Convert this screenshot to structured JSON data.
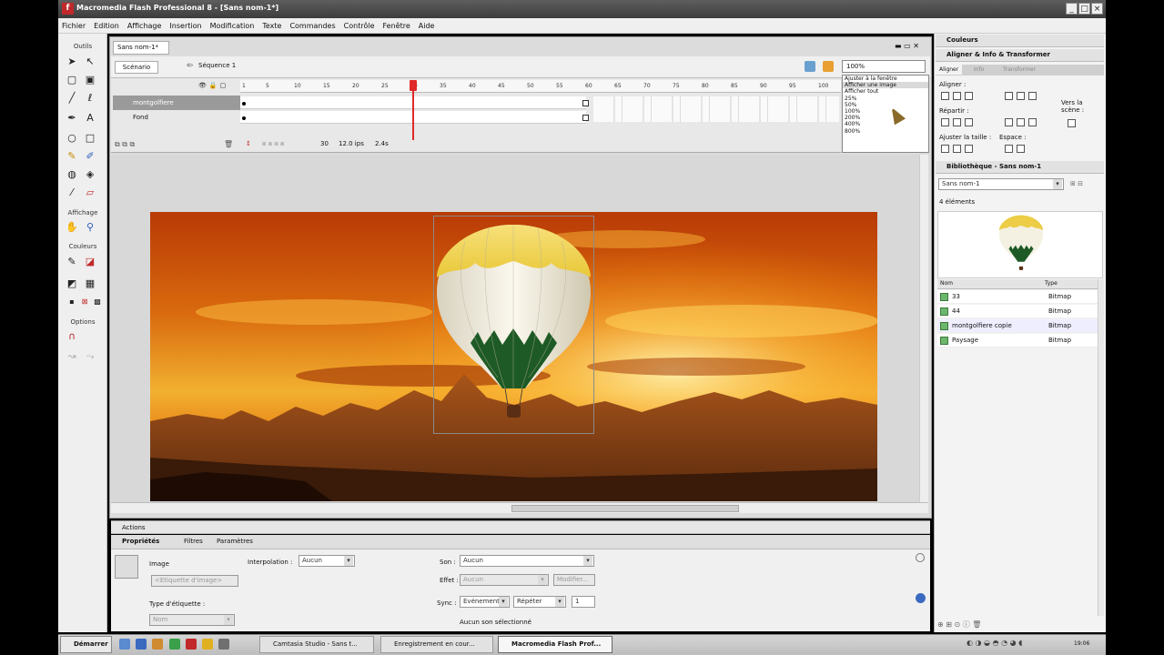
{
  "window": {
    "title": "Macromedia Flash Professional 8 - [Sans nom-1*]",
    "app_icon": "flash-icon"
  },
  "menu": [
    "Fichier",
    "Edition",
    "Affichage",
    "Insertion",
    "Modification",
    "Texte",
    "Commandes",
    "Contrôle",
    "Fenêtre",
    "Aide"
  ],
  "tools": {
    "header": "Outils",
    "view_header": "Affichage",
    "colors_header": "Couleurs",
    "options_header": "Options"
  },
  "document": {
    "tab": "Sans nom-1*",
    "scene_button": "Scénario",
    "sequence": "Séquence 1",
    "zoom": "100%",
    "zoom_options": [
      "Ajuster à la fenêtre",
      "Afficher une image",
      "Afficher tout",
      "25%",
      "50%",
      "100%",
      "200%",
      "400%",
      "800%"
    ]
  },
  "timeline": {
    "frame_numbers": [
      "1",
      "5",
      "10",
      "15",
      "20",
      "25",
      "30",
      "35",
      "40",
      "45",
      "50",
      "55",
      "60",
      "65",
      "70",
      "75",
      "80",
      "85",
      "90",
      "95",
      "100"
    ],
    "layers": [
      {
        "name": "montgolfiere",
        "selected": true
      },
      {
        "name": "Fond",
        "selected": false
      }
    ],
    "current_frame": "30",
    "fps": "12.0 ips",
    "time": "2.4s"
  },
  "panels": {
    "actions": "Actions",
    "properties_tabs": [
      "Propriétés",
      "Filtres",
      "Paramètres"
    ],
    "image_label": "Image",
    "frame_label_placeholder": "<Etiquette d'image>",
    "label_type": "Type d'étiquette :",
    "label_type_value": "Nom",
    "interpolation_label": "Interpolation :",
    "interpolation_value": "Aucun",
    "sound_label": "Son :",
    "sound_value": "Aucun",
    "effect_label": "Effet :",
    "effect_value": "Aucun",
    "edit_button": "Modifier...",
    "sync_label": "Sync :",
    "sync_value": "Evénement",
    "repeat_value": "Répéter",
    "repeat_count": "1",
    "no_sound": "Aucun son sélectionné"
  },
  "right": {
    "colors": "Couleurs",
    "align_panel": "Aligner & Info & Transformer",
    "align_tabs": [
      "Aligner",
      "Info",
      "Transformer"
    ],
    "align": "Aligner :",
    "distribute": "Répartir :",
    "match_size": "Ajuster la taille :",
    "space": "Espace :",
    "to_stage": "Vers la scène :",
    "library_title": "Bibliothèque - Sans nom-1",
    "library_select": "Sans nom-1",
    "elements_count": "4 éléments",
    "col_name": "Nom",
    "col_type": "Type",
    "items": [
      {
        "name": "33",
        "type": "Bitmap"
      },
      {
        "name": "44",
        "type": "Bitmap"
      },
      {
        "name": "montgolfiere copie",
        "type": "Bitmap"
      },
      {
        "name": "Paysage",
        "type": "Bitmap"
      }
    ]
  },
  "taskbar": {
    "start": "Démarrer",
    "items": [
      "Camtasia Studio - Sans t...",
      "Enregistrement en cour...",
      "Macromedia Flash Prof..."
    ],
    "clock": "19:06"
  }
}
